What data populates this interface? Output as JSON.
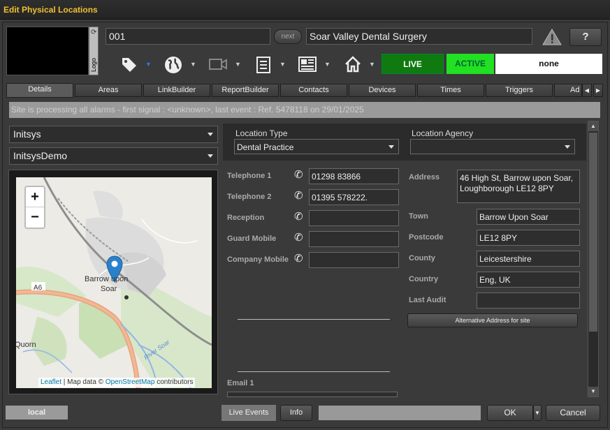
{
  "window": {
    "title": "Edit Physical Locations"
  },
  "header": {
    "logo_label": "Logo",
    "code": "001",
    "next_label": "next",
    "site_name": "Soar Valley Dental Surgery",
    "help_label": "?",
    "live_label": "LIVE",
    "active_label": "ACTIVE",
    "none_label": "none"
  },
  "tabs": [
    "Details",
    "Areas",
    "LinkBuilder",
    "ReportBuilder",
    "Contacts",
    "Devices",
    "Times",
    "Triggers",
    "Ad"
  ],
  "status_message": "Site is processing all alarms - first signal : <unknown>, last event : Ref. 5478118 on 29/01/2025",
  "left": {
    "company": "Initsys",
    "division": "InitsysDemo",
    "map": {
      "zoom_in": "+",
      "zoom_out": "−",
      "place_label_1": "Barrow upon",
      "place_label_2": "Soar",
      "road_label": "A6",
      "place_label_3": "Quorn",
      "river_label": "River Soar",
      "attribution_leaflet": "Leaflet",
      "attribution_sep": " | Map data © ",
      "attribution_osm": "OpenStreetMap",
      "attribution_tail": " contributors"
    }
  },
  "details": {
    "location_type_label": "Location Type",
    "location_type_value": "Dental Practice",
    "location_agency_label": "Location Agency",
    "location_agency_value": "",
    "telephone1_label": "Telephone 1",
    "telephone1_value": "01298 83866",
    "telephone2_label": "Telephone 2",
    "telephone2_value": "01395 578222.",
    "reception_label": "Reception",
    "reception_value": "",
    "guard_mobile_label": "Guard Mobile",
    "guard_mobile_value": "",
    "company_mobile_label": "Company Mobile",
    "company_mobile_value": "",
    "email1_label": "Email 1",
    "address_label": "Address",
    "address_line1": "46 High St, Barrow upon Soar,",
    "address_line2": "Loughborough LE12 8PY",
    "town_label": "Town",
    "town_value": "Barrow Upon Soar",
    "postcode_label": "Postcode",
    "postcode_value": "LE12 8PY",
    "county_label": "County",
    "county_value": "Leicestershire",
    "country_label": "Country",
    "country_value": "Eng, UK",
    "last_audit_label": "Last Audit",
    "last_audit_value": "",
    "alt_address_button": "Alternative Address for site"
  },
  "footer": {
    "local_label": "local",
    "live_events_label": "Live Events",
    "info_label": "Info",
    "ok_label": "OK",
    "cancel_label": "Cancel"
  },
  "colors": {
    "title": "#f0c030",
    "live_bg": "#0f7a0f",
    "active_bg": "#22e022",
    "marker": "#2a81cb"
  }
}
